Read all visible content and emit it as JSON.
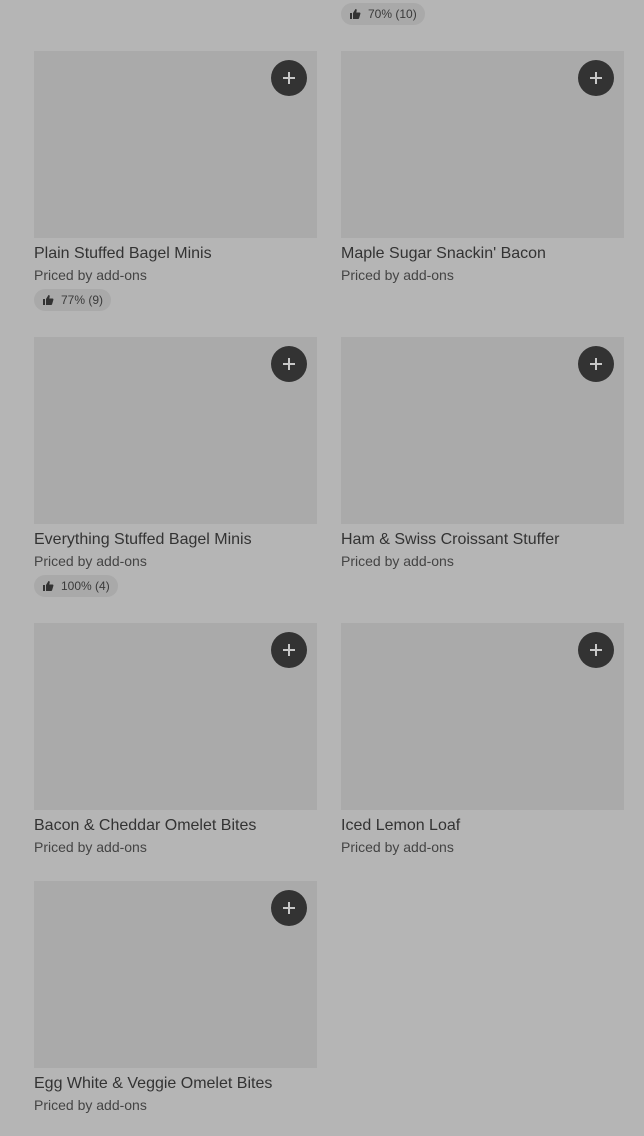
{
  "top_item": {
    "rating_text": "70% (10)"
  },
  "items": [
    {
      "title": "Plain Stuffed Bagel Minis",
      "price": "Priced by add-ons",
      "rating": "77% (9)"
    },
    {
      "title": "Maple Sugar Snackin' Bacon",
      "price": "Priced by add-ons",
      "rating": null
    },
    {
      "title": "Everything Stuffed Bagel Minis",
      "price": "Priced by add-ons",
      "rating": "100% (4)"
    },
    {
      "title": "Ham & Swiss Croissant Stuffer",
      "price": "Priced by add-ons",
      "rating": null
    },
    {
      "title": "Bacon & Cheddar Omelet Bites",
      "price": "Priced by add-ons",
      "rating": null
    },
    {
      "title": "Iced Lemon Loaf",
      "price": "Priced by add-ons",
      "rating": null
    },
    {
      "title": "Egg White & Veggie Omelet Bites",
      "price": "Priced by add-ons",
      "rating": null
    }
  ],
  "icons": {
    "add": "plus-icon",
    "rating": "thumbs-up-icon"
  }
}
